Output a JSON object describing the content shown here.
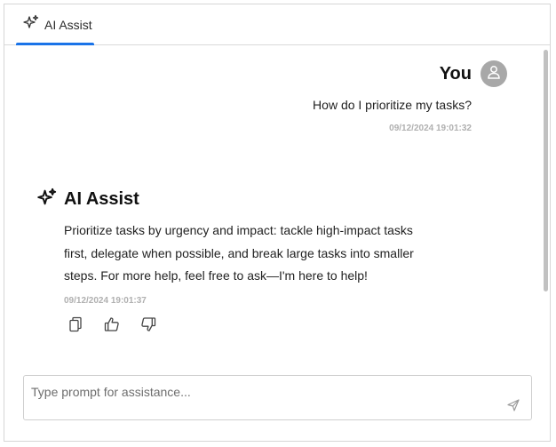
{
  "tab": {
    "label": "AI Assist",
    "icon": "sparkle-icon"
  },
  "colors": {
    "accent": "#1a73e8",
    "avatar_bg": "#a8a8a8",
    "timestamp": "#b0b0b0",
    "border": "#d6d6d6"
  },
  "conversation": {
    "user": {
      "name": "You",
      "avatar_icon": "user-icon",
      "message": "How do I prioritize my tasks?",
      "timestamp": "09/12/2024 19:01:32"
    },
    "assistant": {
      "name": "AI Assist",
      "icon": "sparkle-icon",
      "message": "Prioritize tasks by urgency and impact: tackle high-impact tasks first, delegate when possible, and break large tasks into smaller steps. For more help, feel free to ask—I'm here to help!",
      "timestamp": "09/12/2024 19:01:37",
      "actions": [
        {
          "icon": "copy-icon"
        },
        {
          "icon": "thumbs-up-icon"
        },
        {
          "icon": "thumbs-down-icon"
        }
      ]
    }
  },
  "prompt": {
    "value": "",
    "placeholder": "Type prompt for assistance...",
    "send_icon": "send-icon"
  }
}
